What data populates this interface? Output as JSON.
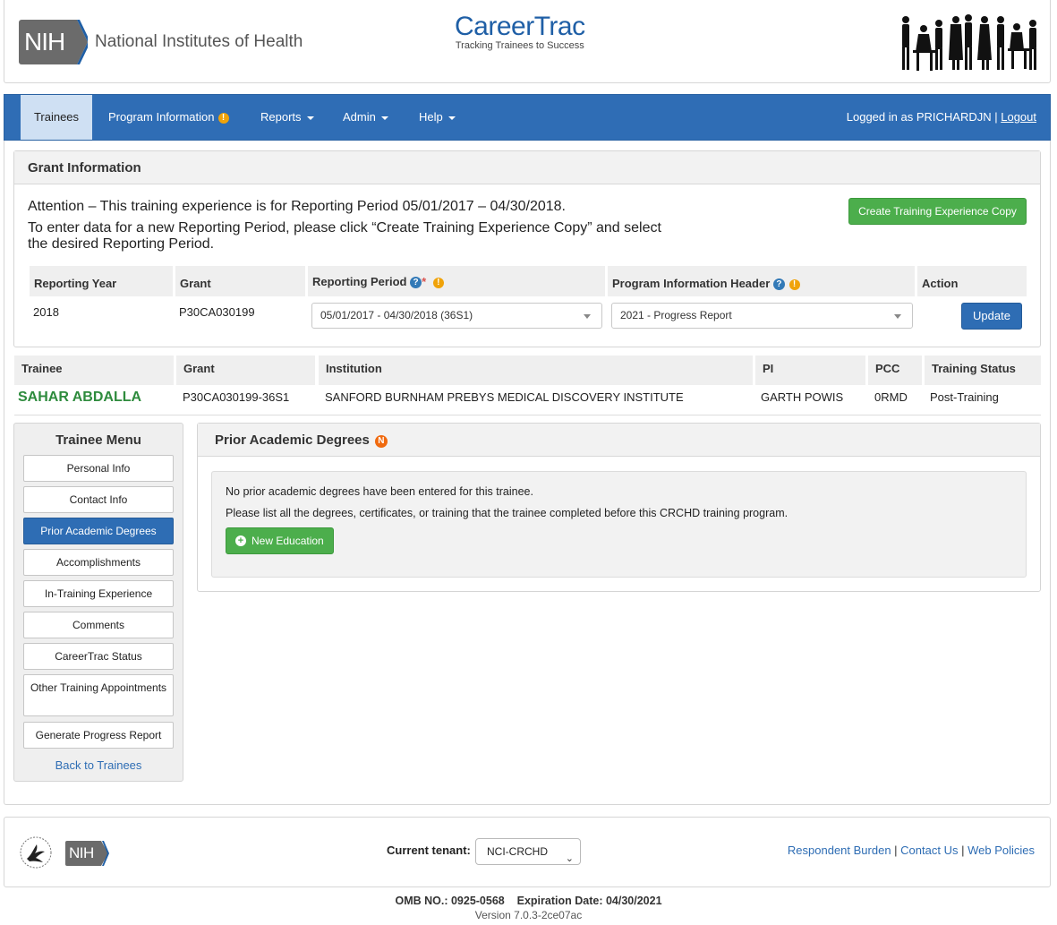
{
  "header": {
    "nih_abbrev": "NIH",
    "nih_name": "National Institutes of Health",
    "app_title": "CareerTrac",
    "app_tagline": "Tracking Trainees to Success"
  },
  "nav": {
    "items": [
      {
        "label": "Trainees"
      },
      {
        "label": "Program Information"
      },
      {
        "label": "Reports"
      },
      {
        "label": "Admin"
      },
      {
        "label": "Help"
      }
    ],
    "logged_in_prefix": "Logged in as PRICHARDJN |",
    "logout": "Logout"
  },
  "grant_info": {
    "title": "Grant Information",
    "attention_line1": "Attention – This training experience is for Reporting Period 05/01/2017 – 04/30/2018.",
    "attention_line2": "To enter data for a new Reporting Period, please click “Create Training Experience Copy” and select the desired Reporting Period.",
    "copy_button": "Create Training Experience Copy",
    "columns": [
      "Reporting Year",
      "Grant",
      "Reporting Period",
      "Program Information Header",
      "Action"
    ],
    "reporting_year": "2018",
    "grant": "P30CA030199",
    "reporting_period_value": "05/01/2017 - 04/30/2018 (36S1)",
    "program_header_value": "2021 - Progress Report",
    "update_button": "Update"
  },
  "trainee_table": {
    "columns": [
      "Trainee",
      "Grant",
      "Institution",
      "PI",
      "PCC",
      "Training Status"
    ],
    "row": {
      "trainee": "SAHAR ABDALLA",
      "grant": "P30CA030199-36S1",
      "institution": "SANFORD BURNHAM PREBYS MEDICAL DISCOVERY INSTITUTE",
      "pi": "GARTH POWIS",
      "pcc": "0RMD",
      "status": "Post-Training"
    }
  },
  "trainee_menu": {
    "title": "Trainee Menu",
    "items": [
      {
        "label": "Personal Info"
      },
      {
        "label": "Contact Info"
      },
      {
        "label": "Prior Academic Degrees"
      },
      {
        "label": "Accomplishments"
      },
      {
        "label": "In-Training Experience"
      },
      {
        "label": "Comments"
      },
      {
        "label": "CareerTrac Status"
      },
      {
        "label": "Other Training Appointments"
      },
      {
        "label": "Generate Progress Report"
      }
    ],
    "back_link": "Back to Trainees"
  },
  "prior_degrees": {
    "title": "Prior Academic Degrees",
    "badge": "N",
    "message1": "No prior academic degrees have been entered for this trainee.",
    "message2": "Please list all the degrees, certificates, or training that the trainee completed before this CRCHD training program.",
    "new_button": "New Education"
  },
  "footer": {
    "tenant_label": "Current tenant:",
    "tenant_value": "NCI-CRCHD",
    "links": [
      "Respondent Burden",
      "Contact Us",
      "Web Policies"
    ],
    "omb": "OMB NO.: 0925-0568    Expiration Date: 04/30/2021",
    "version": "Version 7.0.3-2ce07ac"
  },
  "colors": {
    "nav_blue": "#2f6db5",
    "active_tab": "#cfe0f3",
    "green_button": "#4cae4c",
    "trainee_name": "#2e8b3d",
    "warning_orange": "#f0a30a"
  },
  "icons": [
    "nih-logo-icon",
    "people-silhouettes-icon",
    "help-question-icon",
    "warning-icon",
    "new-badge-icon",
    "plus-circle-icon",
    "hhs-eagle-icon",
    "chevron-down-icon"
  ]
}
